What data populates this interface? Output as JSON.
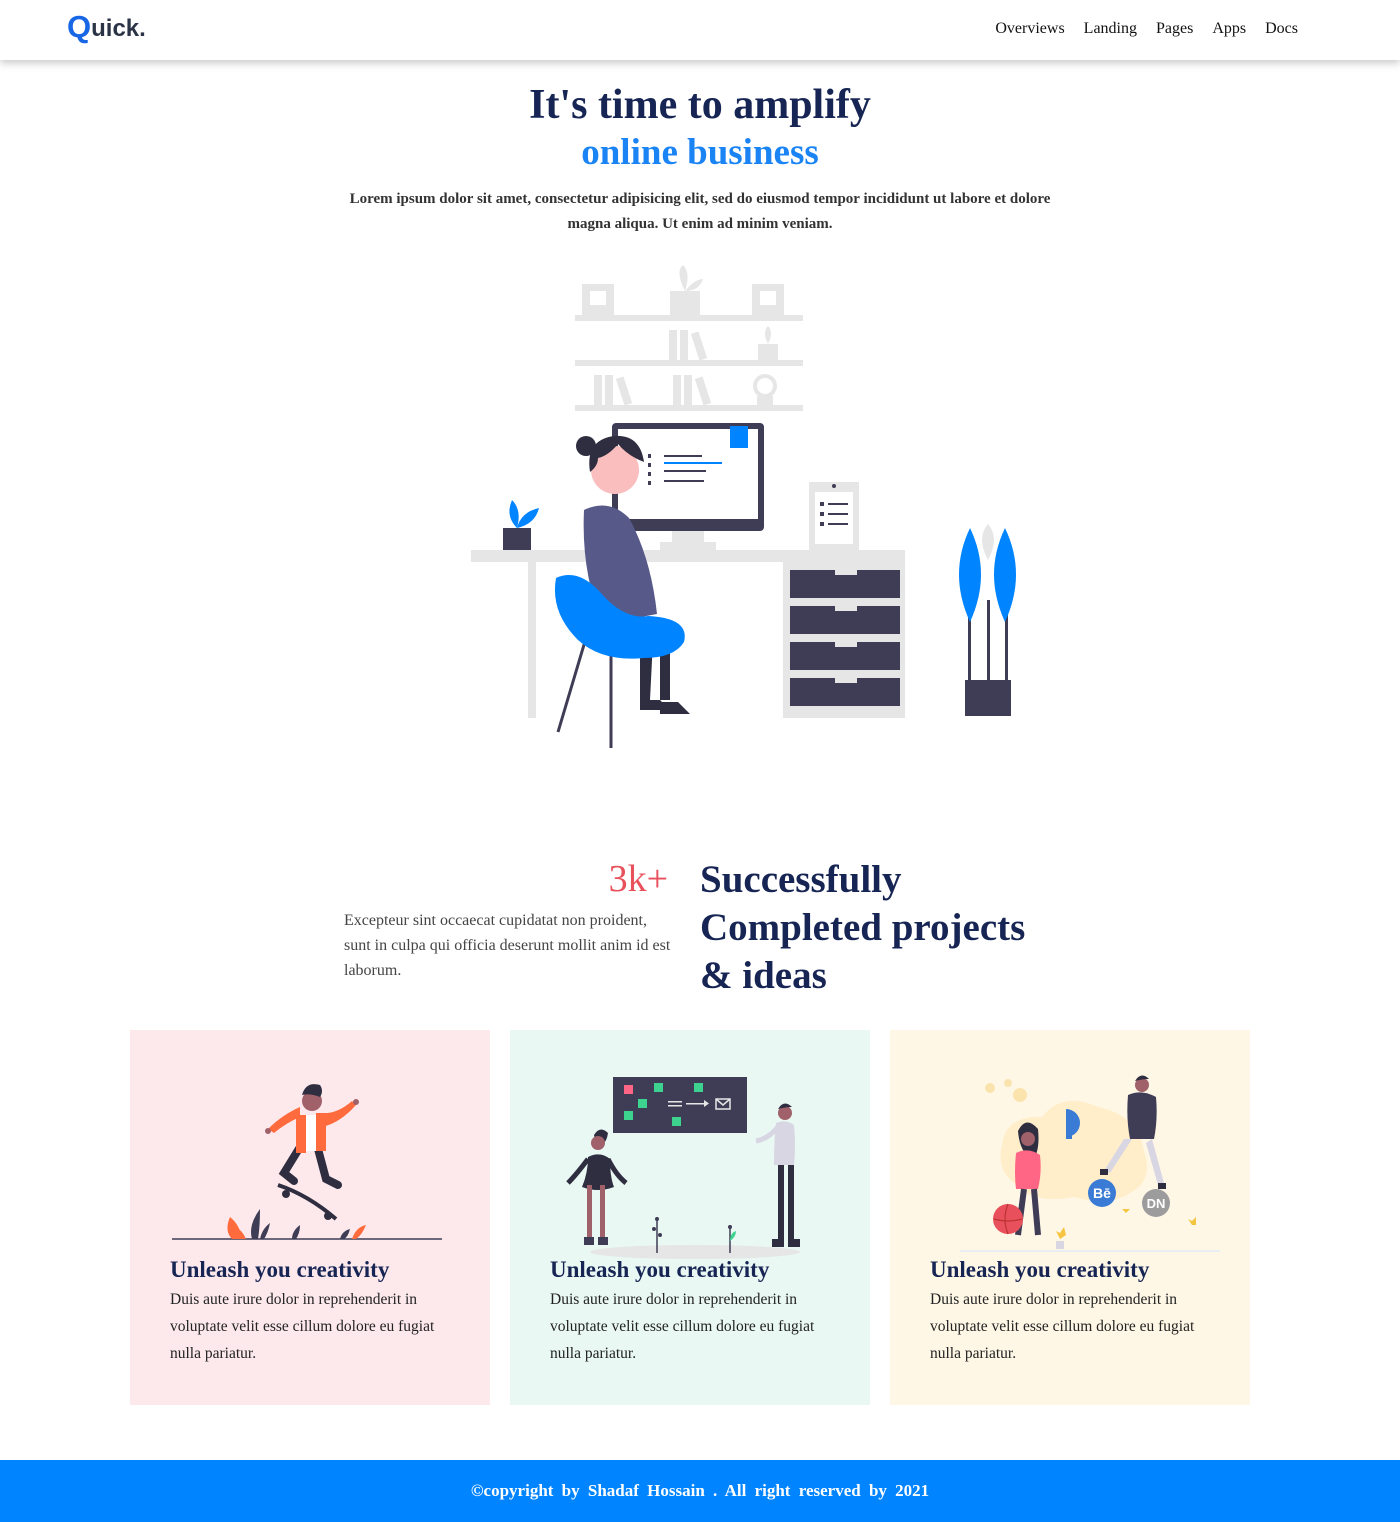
{
  "navbar": {
    "logo": {
      "initial": "Q",
      "rest": "uick."
    },
    "links": [
      "Overviews",
      "Landing",
      "Pages",
      "Apps",
      "Docs"
    ]
  },
  "hero": {
    "title": "It's time to amplify",
    "subtitle": "online business",
    "text": "Lorem ipsum dolor sit amet, consectetur adipisicing elit, sed do eiusmod tempor incididunt ut labore et dolore magna aliqua. Ut enim ad minim veniam."
  },
  "stats": {
    "number": "3k+",
    "text": "Excepteur sint occaecat cupidatat non proident, sunt in culpa qui officia deserunt mollit anim id est laborum.",
    "heading": "Successfully Completed projects & ideas"
  },
  "cards": [
    {
      "title": "Unleash you creativity",
      "text": "Duis aute irure dolor in reprehenderit in voluptate velit esse cillum dolore eu fugiat nulla pariatur."
    },
    {
      "title": "Unleash you creativity",
      "text": "Duis aute irure dolor in reprehenderit in voluptate velit esse cillum dolore eu fugiat nulla pariatur."
    },
    {
      "title": "Unleash you creativity",
      "text": "Duis aute irure dolor in reprehenderit in voluptate velit esse cillum dolore eu fugiat nulla pariatur."
    }
  ],
  "card3_badges": {
    "behance": "Bē",
    "dribbble_dn": "DN"
  },
  "footer": {
    "copyright": "©copyright by Shadaf Hossain . All right reserved by 2021"
  },
  "colors": {
    "accent_blue": "#1a84f5",
    "navy": "#172554",
    "stat_red": "#e8505b",
    "footer_blue": "#0084ff",
    "card_pink": "#fde9ec",
    "card_mint": "#e9f8f3",
    "card_cream": "#fff7e6"
  }
}
